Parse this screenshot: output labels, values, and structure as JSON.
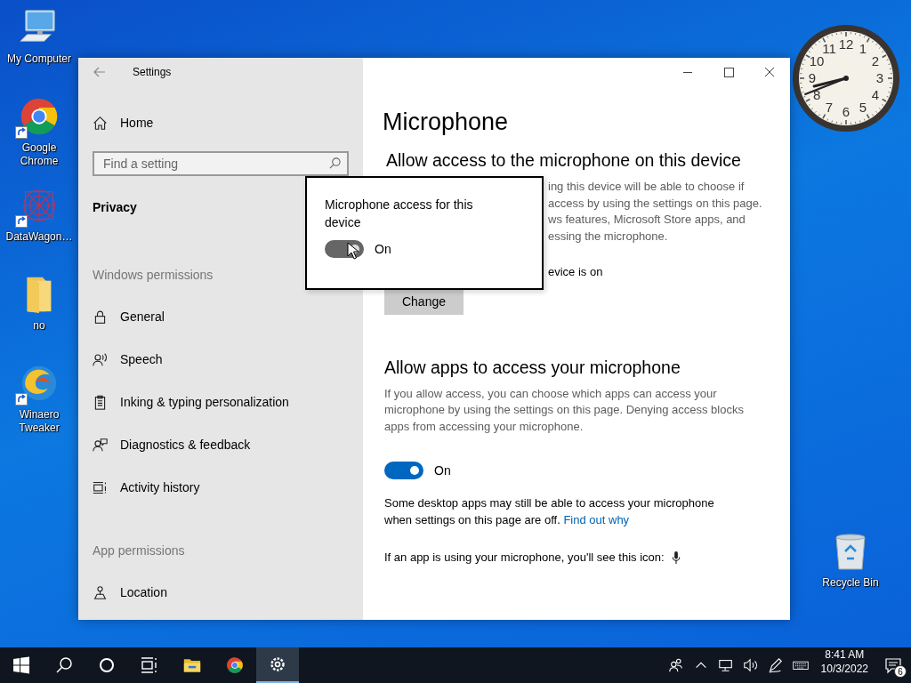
{
  "desktop_icons": [
    {
      "label": "My Computer",
      "kind": "computer",
      "shortcut": false
    },
    {
      "label": "Google Chrome",
      "kind": "chrome",
      "shortcut": true
    },
    {
      "label": "DataWagon…",
      "kind": "pattern",
      "shortcut": true
    },
    {
      "label": "no",
      "kind": "folder",
      "shortcut": false
    },
    {
      "label": "Winaero Tweaker",
      "kind": "swirl",
      "shortcut": true
    }
  ],
  "clock_gadget": {
    "numerals": [
      "11",
      "12",
      "1",
      "10",
      "2",
      "9",
      "3",
      "8",
      "4",
      "7",
      "6",
      "5"
    ]
  },
  "recycle_bin": {
    "label": "Recycle Bin"
  },
  "window": {
    "title": "Settings"
  },
  "sidebar": {
    "home": "Home",
    "search": {
      "placeholder": "Find a setting"
    },
    "category": "Privacy",
    "sections": [
      {
        "heading": "Windows permissions",
        "items": [
          {
            "label": "General",
            "kind": "lock"
          },
          {
            "label": "Speech",
            "kind": "speech"
          },
          {
            "label": "Inking & typing personalization",
            "kind": "clipboard"
          },
          {
            "label": "Diagnostics & feedback",
            "kind": "feedback"
          },
          {
            "label": "Activity history",
            "kind": "timeline"
          }
        ]
      },
      {
        "heading": "App permissions",
        "items": [
          {
            "label": "Location",
            "kind": "location"
          }
        ]
      }
    ]
  },
  "content": {
    "title": "Microphone",
    "device_section": {
      "heading": "Allow access to the microphone on this device",
      "description_lines": [
        "ing this device will be able to choose if",
        "access by using the settings on this page.",
        "ws features, Microsoft Store apps, and",
        "essing the microphone."
      ],
      "status": "evice is on",
      "button": "Change"
    },
    "apps_section": {
      "heading": "Allow apps to access your microphone",
      "description": "If you allow access, you can choose which apps can access your microphone by using the settings on this page. Denying access blocks apps from accessing your microphone.",
      "toggle": {
        "on": true,
        "label": "On"
      },
      "note": "Some desktop apps may still be able to access your microphone when settings on this page are off.",
      "link": "Find out why",
      "icon_note": "If an app is using your microphone, you'll see this icon:"
    }
  },
  "popup": {
    "title": "Microphone access for this device",
    "toggle": {
      "on": true,
      "label": "On"
    }
  },
  "taskbar": {
    "apps": [
      {
        "kind": "start",
        "selected": false
      },
      {
        "kind": "search",
        "selected": false
      },
      {
        "kind": "cortana",
        "selected": false
      },
      {
        "kind": "taskview",
        "selected": false
      },
      {
        "kind": "explorer",
        "selected": false
      },
      {
        "kind": "chrome",
        "selected": false
      },
      {
        "kind": "settings",
        "selected": true
      }
    ],
    "time": "8:41 AM",
    "date": "10/3/2022",
    "notification_count": "6"
  }
}
